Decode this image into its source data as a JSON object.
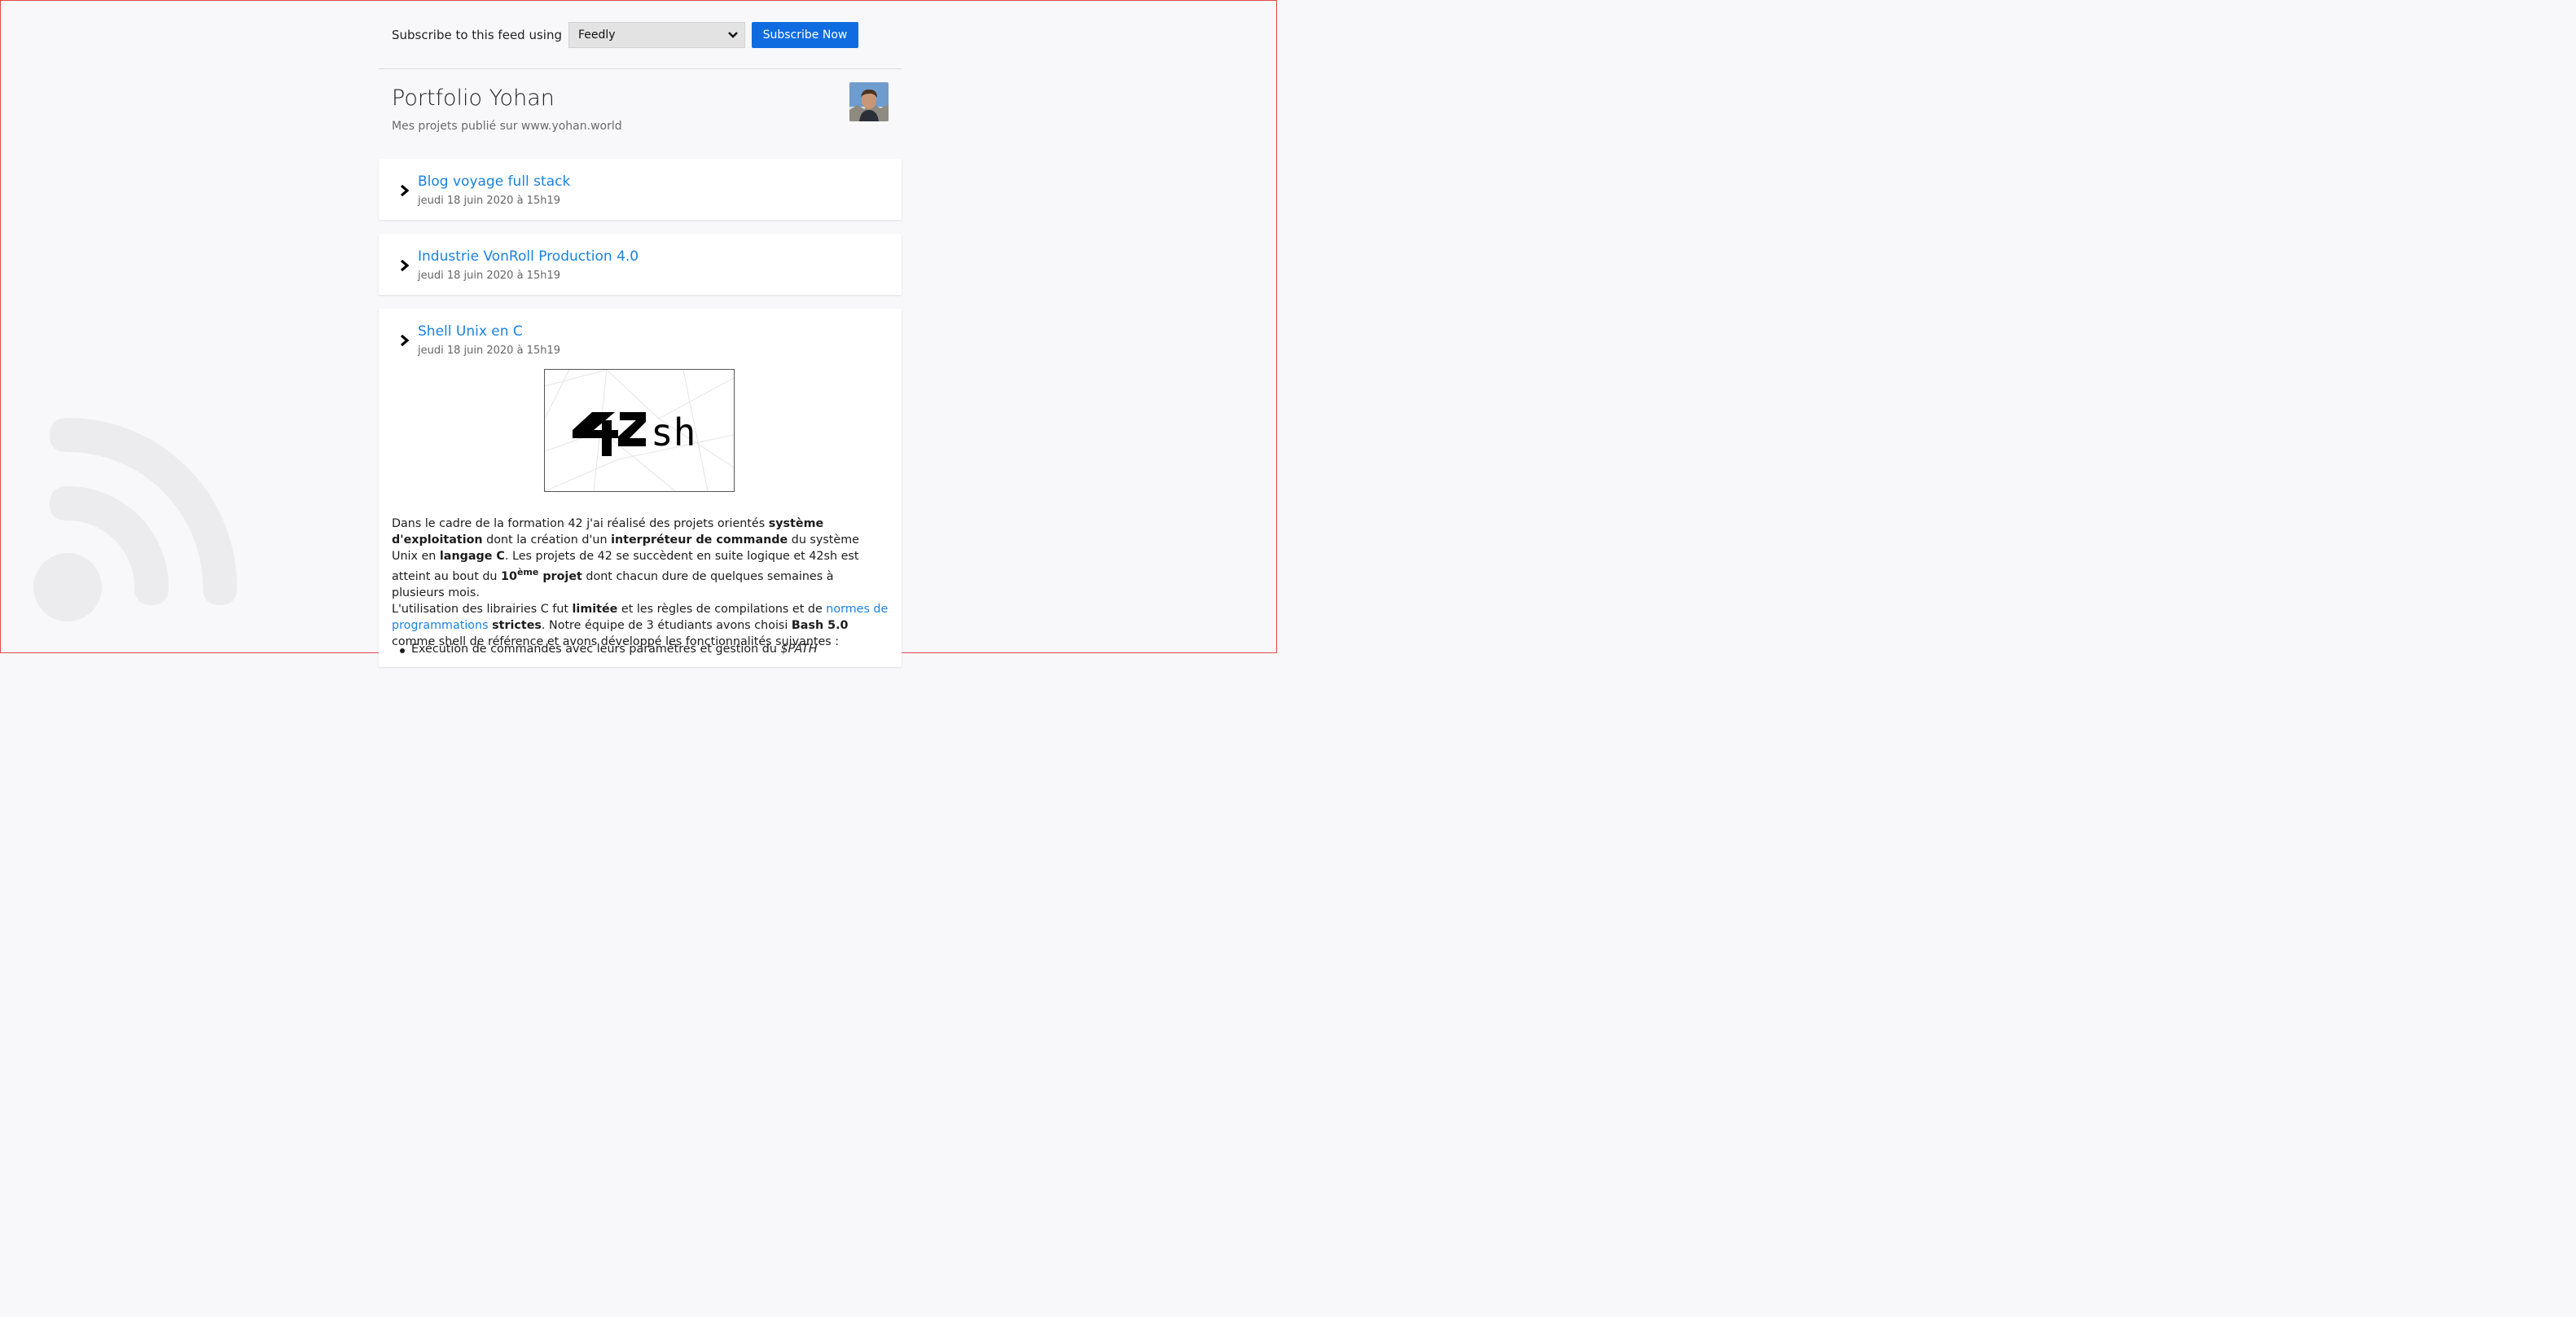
{
  "subscribe": {
    "label": "Subscribe to this feed using",
    "selected_reader": "Feedly",
    "button_label": "Subscribe Now"
  },
  "feed": {
    "title": "Portfolio Yohan",
    "subtitle": "Mes projets publié sur www.yohan.world"
  },
  "items": [
    {
      "title": "Blog voyage full stack",
      "date": "jeudi 18 juin 2020 à 15h19"
    },
    {
      "title": "Industrie VonRoll Production 4.0",
      "date": "jeudi 18 juin 2020 à 15h19"
    },
    {
      "title": "Shell Unix en C",
      "date": "jeudi 18 juin 2020 à 15h19"
    }
  ],
  "article": {
    "logo_text": "42sh",
    "p1_a": "Dans le cadre de la formation 42 j'ai réalisé des projets orientés ",
    "p1_b": "système d'exploitation",
    "p1_c": " dont la création d'un ",
    "p1_d": "interpréteur de commande",
    "p1_e": " du système Unix en ",
    "p1_f": "langage C",
    "p1_g": ". Les projets de 42 se succèdent en suite logique et 42sh est atteint au bout du ",
    "p1_h": "10",
    "p1_sup": "ème",
    "p1_i": " projet",
    "p1_j": " dont chacun dure de quelques semaines à plusieurs mois.",
    "p2_a": "L'utilisation des librairies C fut ",
    "p2_b": "limitée",
    "p2_c": " et les règles de compilations et de ",
    "p2_link": "normes de programmations",
    "p2_d": " ",
    "p2_e": "strictes",
    "p2_f": ". Notre équipe de 3 étudiants avons choisi ",
    "p2_g": "Bash 5.0",
    "p2_h": " comme shell de référence et avons développé les fonctionnalités suivantes :",
    "bullet1_a": "Exécution de commandes avec leurs paramètres et gestion du ",
    "bullet1_b": "$PATH"
  }
}
